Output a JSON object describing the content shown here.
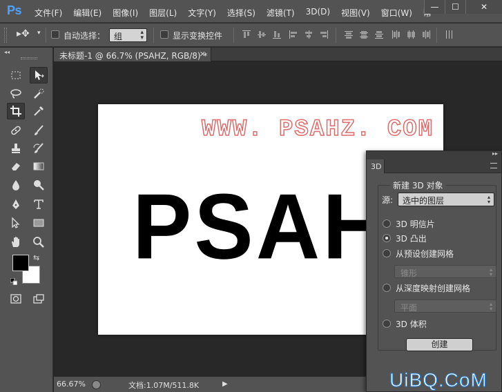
{
  "app": {
    "logo": "Ps"
  },
  "menu": [
    "文件(F)",
    "编辑(E)",
    "图像(I)",
    "图层(L)",
    "文字(Y)",
    "选择(S)",
    "滤镜(T)",
    "3D(D)",
    "视图(V)",
    "窗口(W)",
    "帮"
  ],
  "window_controls": {
    "min": "—",
    "max": "☐",
    "close": "✕"
  },
  "options": {
    "tool_preset": "▸✥",
    "auto_select_label": "自动选择：",
    "auto_select_value": "组",
    "show_transform_label": "显示变换控件"
  },
  "document": {
    "tab_title": "未标题-1 @ 66.7% (PSAHZ, RGB/8) *",
    "close": "✕"
  },
  "canvas": {
    "url_text": "WWW. PSAHZ. COM",
    "main_text": "PSAHZ"
  },
  "status": {
    "zoom": "66.67%",
    "doc_size": "文档:1.07M/511.8K",
    "arrow": "▶"
  },
  "panel3d": {
    "tab": "3D",
    "group_title": "新建 3D 对象",
    "source_label": "源:",
    "source_value": "选中的图层",
    "options": [
      {
        "label": "3D 明信片",
        "selected": false
      },
      {
        "label": "3D 凸出",
        "selected": true
      },
      {
        "label": "从预设创建网格",
        "selected": false
      },
      {
        "label": "从深度映射创建网格",
        "selected": false
      },
      {
        "label": "3D 体积",
        "selected": false
      }
    ],
    "preset_value": "锥形",
    "depth_value": "平面",
    "create_label": "创建"
  },
  "watermark": "UiBQ.CoM",
  "colors": {
    "foreground": "#000000",
    "background": "#ffffff",
    "url_stroke": "#e06a6a",
    "accent": "#4ea3ff"
  }
}
